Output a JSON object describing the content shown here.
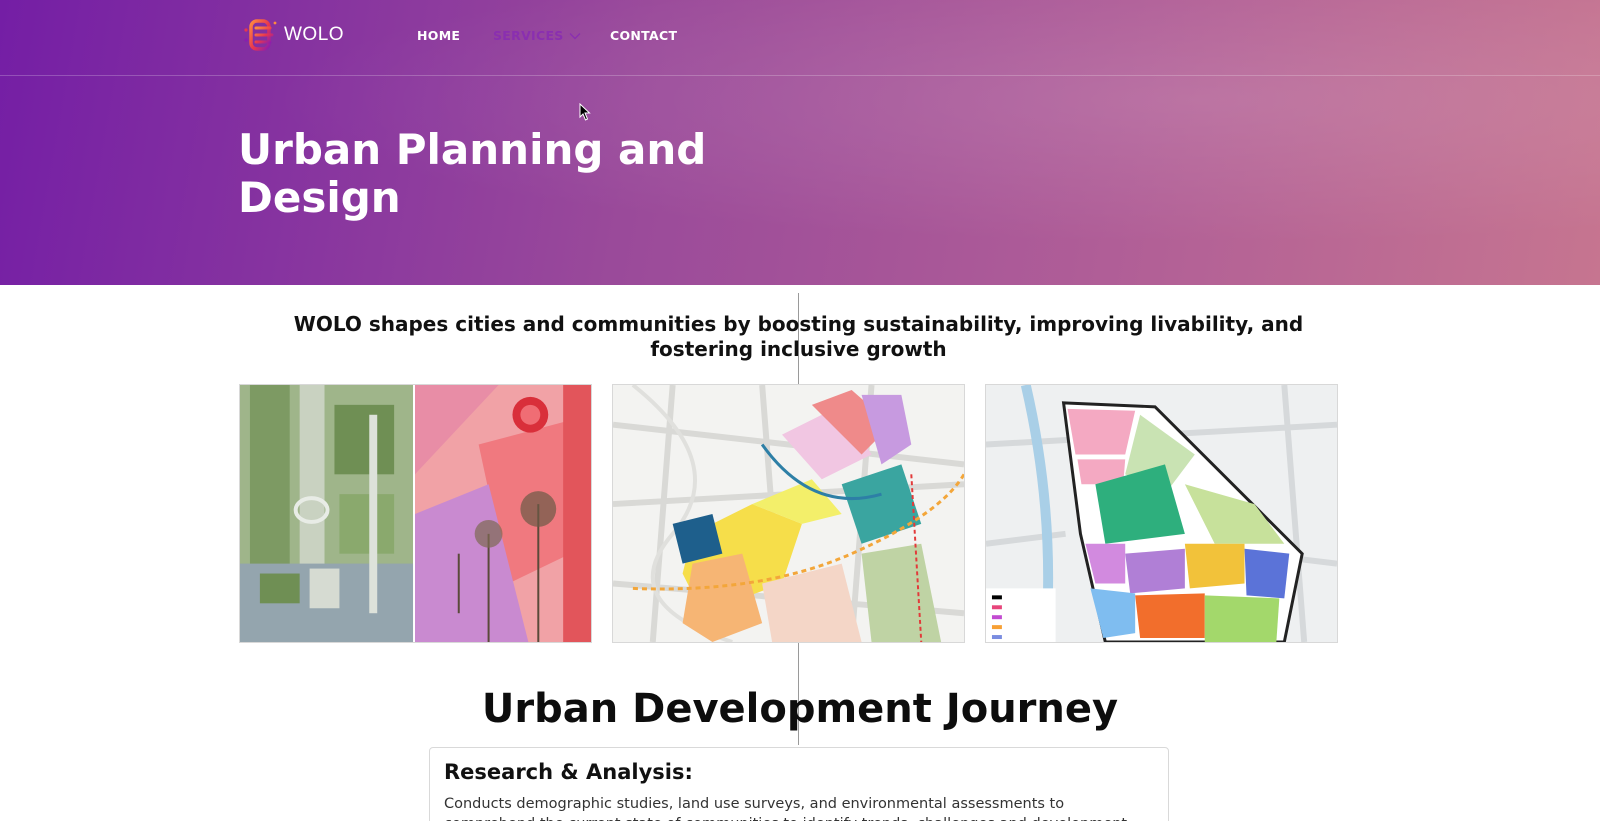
{
  "brand": {
    "name": "WOLO"
  },
  "nav": {
    "home": "HOME",
    "services": "SERVICES",
    "contact": "CONTACT"
  },
  "hero": {
    "title": "Urban Planning and Design"
  },
  "tagline": "WOLO shapes cities and communities by boosting sustainability, improving livability, and fostering inclusive growth",
  "journey": {
    "title": "Urban Development Journey",
    "steps": [
      {
        "title": "Research & Analysis:",
        "text": "Conducts demographic studies, land use surveys, and environmental assessments to comprehend the current state of communities to identify trends, challenges and development opportunities."
      }
    ]
  },
  "colors": {
    "hero_start": "#741ea5",
    "hero_end": "#c67590",
    "nav_active": "#8a2fb0"
  },
  "icons": [
    "brand-logo-icon",
    "chevron-down-icon",
    "mouse-cursor-icon"
  ]
}
